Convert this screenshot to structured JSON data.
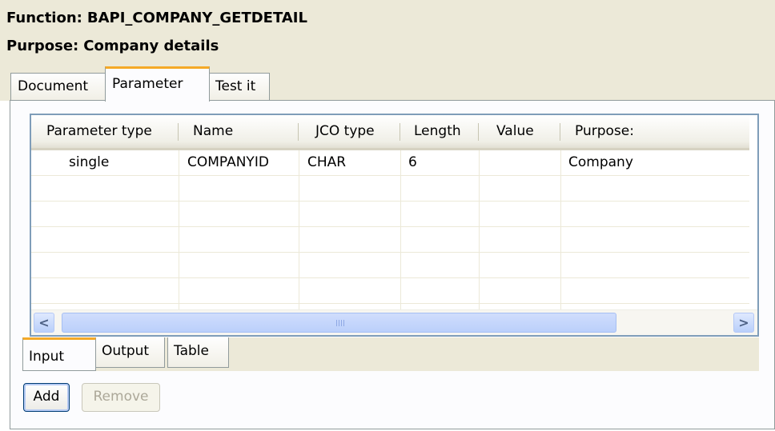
{
  "header": {
    "function_label": "Function:",
    "function_value": "BAPI_COMPANY_GETDETAIL",
    "purpose_label": "Purpose:",
    "purpose_value": "Company details"
  },
  "tabs": [
    {
      "label": "Document",
      "active": false
    },
    {
      "label": "Parameter",
      "active": true
    },
    {
      "label": "Test it",
      "active": false
    }
  ],
  "table": {
    "columns": [
      "Parameter type",
      "Name",
      "JCO type",
      "Length",
      "Value",
      "Purpose:"
    ],
    "rows": [
      [
        "single",
        "COMPANYID",
        "CHAR",
        "6",
        "",
        "Company"
      ]
    ]
  },
  "scrollbar": {
    "left_arrow": "<",
    "right_arrow": ">",
    "position_fraction": 0.0
  },
  "subtabs": [
    {
      "label": "Input",
      "active": true
    },
    {
      "label": "Output",
      "active": false
    },
    {
      "label": "Table",
      "active": false
    }
  ],
  "buttons": {
    "add_label": "Add",
    "remove_label": "Remove",
    "remove_enabled": false
  },
  "colors": {
    "chrome_bg": "#ece9d8",
    "active_tab_accent": "#f5a927",
    "table_border": "#7f9db9"
  }
}
